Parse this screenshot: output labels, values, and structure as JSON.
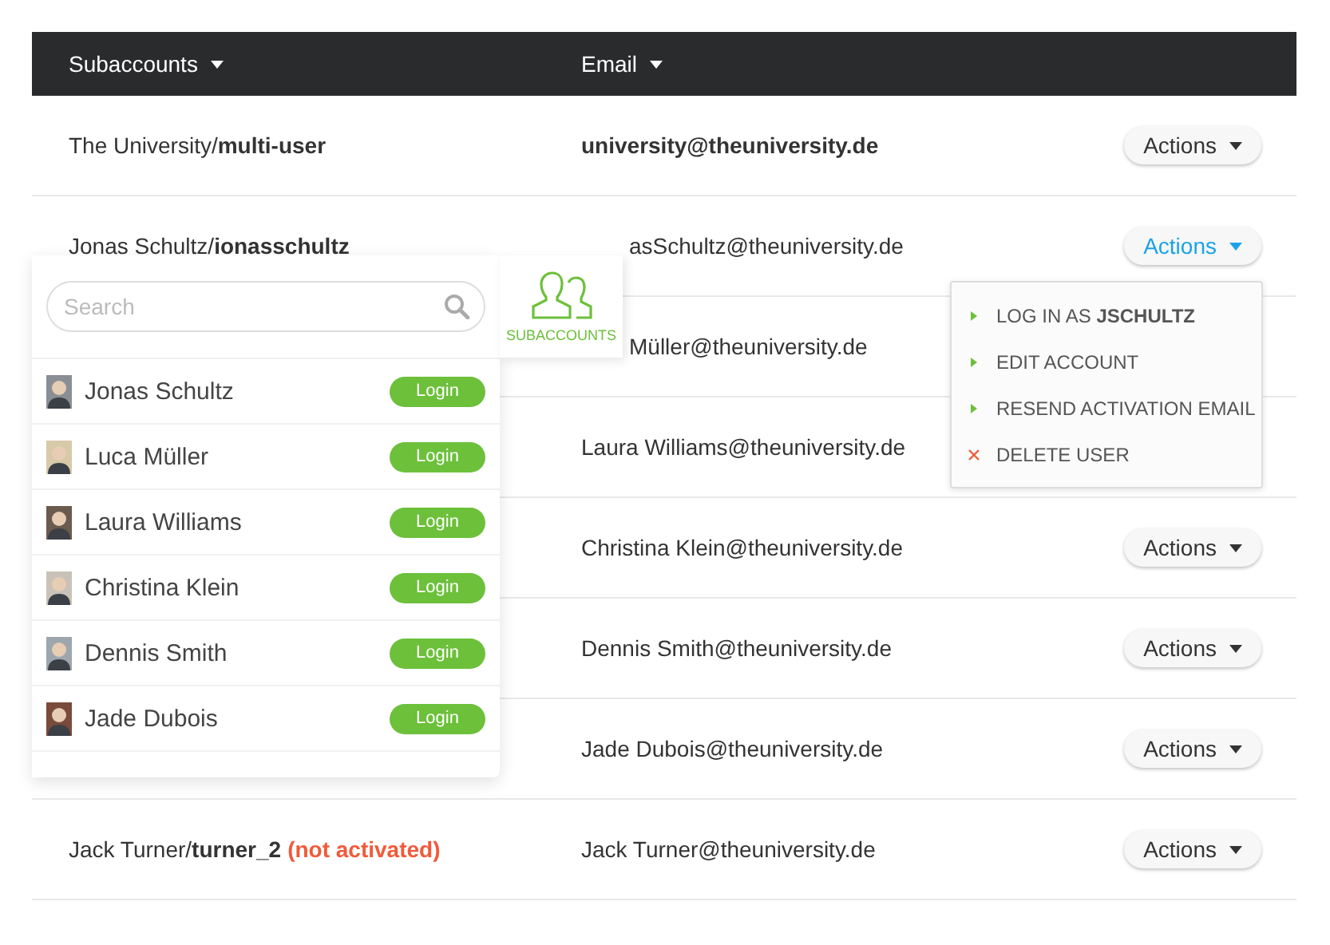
{
  "table": {
    "columns": [
      {
        "label": "Subaccounts"
      },
      {
        "label": "Email"
      }
    ],
    "rows": [
      {
        "name": "The University/**multi-user**",
        "email": "university@theuniversity.de",
        "email_bold": true,
        "actions": {
          "label": "Actions",
          "open": false
        }
      },
      {
        "name": "Jonas Schultz/**ionasschultz**",
        "email": "asSchultz@theuniversity.de",
        "email_clipped": true,
        "actions": {
          "label": "Actions",
          "open": true
        }
      },
      {
        "email": "Müller@theuniversity.de",
        "email_clipped": true
      },
      {
        "email": "Laura Williams@theuniversity.de"
      },
      {
        "email": "Christina Klein@theuniversity.de",
        "actions": {
          "label": "Actions",
          "open": false
        }
      },
      {
        "email": "Dennis Smith@theuniversity.de",
        "actions": {
          "label": "Actions",
          "open": false
        }
      },
      {
        "email": "Jade Dubois@theuniversity.de",
        "actions": {
          "label": "Actions",
          "open": false
        }
      },
      {
        "name": "Jack Turner/**turner_2**",
        "status": "(not activated)",
        "email": "Jack Turner@theuniversity.de",
        "actions": {
          "label": "Actions",
          "open": false
        }
      }
    ]
  },
  "actions_menu": {
    "items": [
      {
        "kind": "action",
        "label": "LOG IN AS **JSCHULTZ**"
      },
      {
        "kind": "action",
        "label": "EDIT ACCOUNT"
      },
      {
        "kind": "action",
        "label": "RESEND ACTIVATION EMAIL"
      },
      {
        "kind": "delete",
        "label": "DELETE USER"
      }
    ]
  },
  "subaccounts_panel": {
    "tab": {
      "label": "SUBACCOUNTS"
    },
    "search": {
      "placeholder": "Search"
    },
    "users": [
      {
        "name": "Jonas Schultz",
        "button": "Login"
      },
      {
        "name": "Luca Müller",
        "button": "Login"
      },
      {
        "name": "Laura Williams",
        "button": "Login"
      },
      {
        "name": "Christina Klein",
        "button": "Login"
      },
      {
        "name": "Dennis Smith",
        "button": "Login"
      },
      {
        "name": "Jade Dubois",
        "button": "Login"
      }
    ]
  }
}
